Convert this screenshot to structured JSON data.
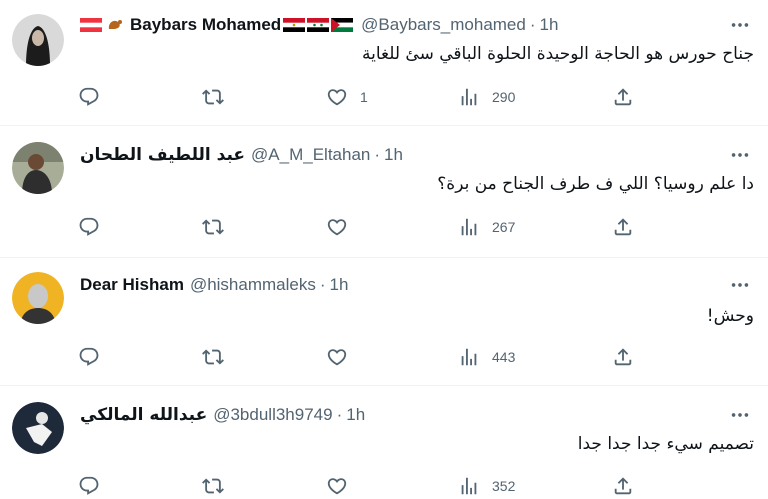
{
  "tweets": [
    {
      "name": "Baybars Mohamed",
      "handle": "@Baybars_mohamed",
      "separator": "·",
      "time": "1h",
      "text": "جناح حورس هو الحاجة الوحيدة الحلوة الباقي سئ للغاية",
      "likes": "1",
      "views": "290",
      "avatar_color": "#2b2b2b"
    },
    {
      "name": "عبد اللطيف الطحان",
      "handle": "@A_M_Eltahan",
      "separator": "·",
      "time": "1h",
      "text": "دا علم روسيا؟ اللي ف طرف الجناح من برة؟",
      "likes": "",
      "views": "267",
      "avatar_color": "#8a8f7c"
    },
    {
      "name": "Dear Hisham",
      "handle": "@hishammaleks",
      "separator": "·",
      "time": "1h",
      "text": "وحش!",
      "likes": "",
      "views": "443",
      "avatar_color": "#f0b323"
    },
    {
      "name": "عبدالله المالكي",
      "handle": "@3bdull3h9749",
      "separator": "·",
      "time": "1h",
      "text": "تصميم سيء جدا جدا جدا",
      "likes": "",
      "views": "352",
      "avatar_color": "#1e2a3a"
    }
  ],
  "icons": {
    "reply": "reply-icon",
    "retweet": "retweet-icon",
    "like": "heart-icon",
    "views": "views-icon",
    "share": "share-icon",
    "more": "more-icon"
  },
  "colors": {
    "text": "#0f1419",
    "secondary": "#536471",
    "divider": "#eff3f4"
  }
}
